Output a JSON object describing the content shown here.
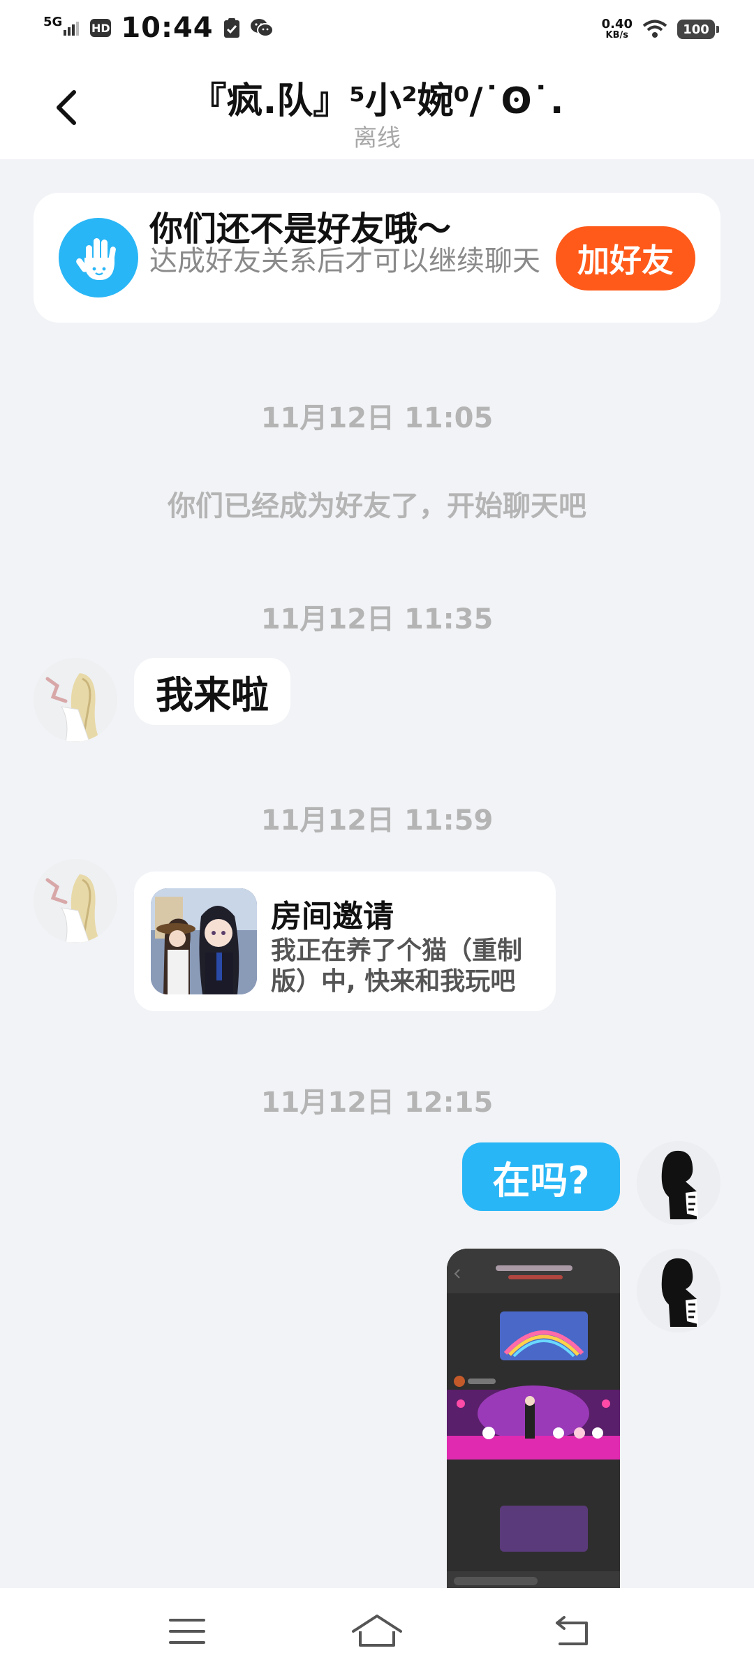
{
  "status_bar": {
    "network": "5G",
    "hd": "HD",
    "time": "10:44",
    "speed_value": "0.40",
    "speed_unit": "KB/s",
    "battery": "100"
  },
  "header": {
    "title": "『疯.队』⁵小²婉⁰/˙ʘ˙.",
    "subtitle": "离线"
  },
  "friend_banner": {
    "title": "你们还不是好友哦～",
    "description": "达成好友关系后才可以继续聊天",
    "button_label": "加好友"
  },
  "messages": {
    "ts1": "11月12日 11:05",
    "system_text": "你们已经成为好友了，开始聊天吧",
    "ts2": "11月12日 11:35",
    "msg1": "我来啦",
    "ts3": "11月12日 11:59",
    "invite_title": "房间邀请",
    "invite_desc": "我正在养了个猫（重制版）中, 快来和我玩吧",
    "ts4": "11月12日 12:15",
    "msg2": "在吗?"
  },
  "colors": {
    "accent_blue": "#29b6f6",
    "accent_orange": "#ff5a1a",
    "background": "#f1f3f6"
  }
}
